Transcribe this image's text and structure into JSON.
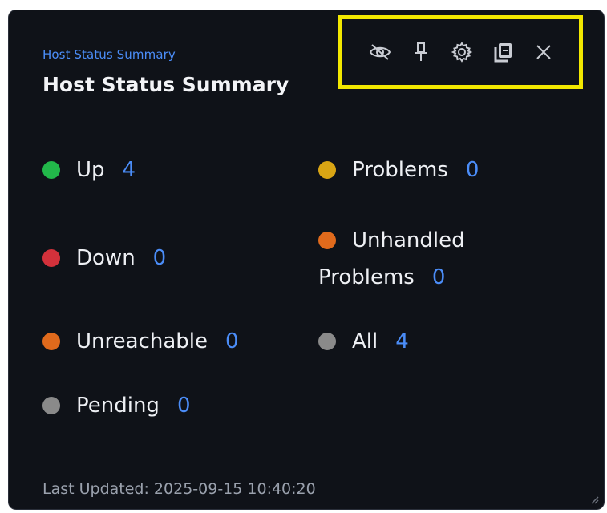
{
  "widget": {
    "subtitle": "Host Status Summary",
    "title": "Host Status Summary",
    "footer": "Last Updated: 2025-09-15 10:40:20"
  },
  "toolbar": {
    "icons": [
      "eye-off-icon",
      "pin-icon",
      "gear-icon",
      "copy-icon",
      "close-icon"
    ]
  },
  "stats": {
    "up": {
      "label": "Up",
      "count": "4",
      "color": "#22b84a"
    },
    "problems": {
      "label": "Problems",
      "count": "0",
      "color": "#d9a514"
    },
    "down": {
      "label": "Down",
      "count": "0",
      "color": "#d3313b"
    },
    "unhandled": {
      "label_line1": "Unhandled",
      "label_line2": "Problems",
      "count": "0",
      "color": "#e06a1c"
    },
    "unreachable": {
      "label": "Unreachable",
      "count": "0",
      "color": "#e06a1c"
    },
    "all": {
      "label": "All",
      "count": "4",
      "color": "#8a8a8a"
    },
    "pending": {
      "label": "Pending",
      "count": "0",
      "color": "#8a8a8a"
    }
  },
  "colors": {
    "accent": "#4b8df8",
    "highlight": "#f2e800",
    "background": "#0f1218"
  }
}
